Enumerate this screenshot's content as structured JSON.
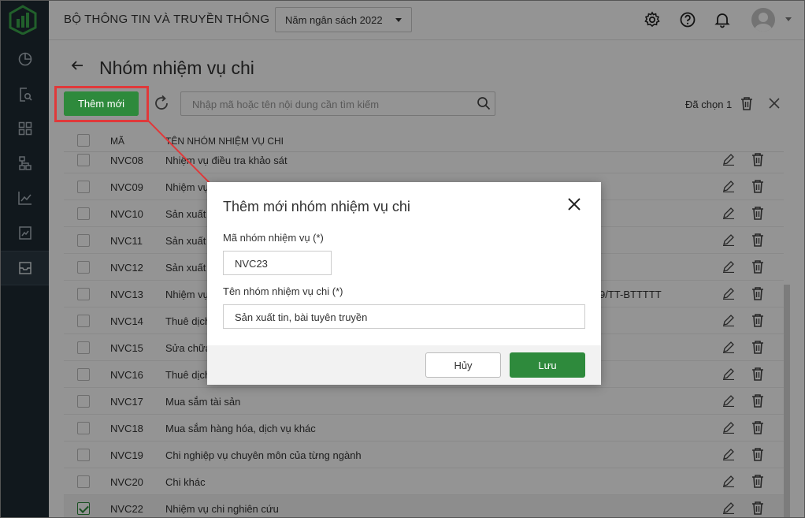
{
  "header": {
    "org_title": "BỘ THÔNG TIN VÀ TRUYỀN THÔNG",
    "budget_year": "Năm ngân sách 2022"
  },
  "page": {
    "title": "Nhóm nhiệm vụ chi",
    "add_button": "Thêm mới",
    "search_placeholder": "Nhập mã hoặc tên nội dung cần tìm kiếm",
    "selected_count": "Đã chọn 1"
  },
  "table": {
    "headers": {
      "code": "MÃ",
      "name": "TÊN NHÓM NHIỆM VỤ CHI"
    },
    "rows": [
      {
        "code": "NVC08",
        "name": "Nhiệm vụ điều tra khảo sát",
        "checked": false
      },
      {
        "code": "NVC09",
        "name": "Nhiệm vụ",
        "checked": false
      },
      {
        "code": "NVC10",
        "name": "Sản xuất",
        "checked": false
      },
      {
        "code": "NVC11",
        "name": "Sản xuất",
        "checked": false
      },
      {
        "code": "NVC12",
        "name": "Sản xuất",
        "checked": false
      },
      {
        "code": "NVC13",
        "name": "Nhiệm vụ",
        "suffix": "9/TT-BTTTTT",
        "checked": false
      },
      {
        "code": "NVC14",
        "name": "Thuê dịch",
        "checked": false
      },
      {
        "code": "NVC15",
        "name": "Sửa chữa",
        "checked": false
      },
      {
        "code": "NVC16",
        "name": "Thuê dịch",
        "checked": false
      },
      {
        "code": "NVC17",
        "name": "Mua sắm tài sản",
        "checked": false
      },
      {
        "code": "NVC18",
        "name": "Mua sắm hàng hóa, dịch vụ khác",
        "checked": false
      },
      {
        "code": "NVC19",
        "name": "Chi nghiệp vụ chuyên môn của từng ngành",
        "checked": false
      },
      {
        "code": "NVC20",
        "name": "Chi khác",
        "checked": false
      },
      {
        "code": "NVC22",
        "name": "Nhiệm vụ chi nghiên cứu",
        "checked": true
      }
    ]
  },
  "dialog": {
    "title": "Thêm mới nhóm nhiệm vụ chi",
    "code_label": "Mã nhóm nhiệm vụ (*)",
    "code_value": "NVC23",
    "name_label": "Tên nhóm nhiệm vụ chi (*)",
    "name_value": "Sản xuất tin, bài tuyên truyền",
    "cancel_label": "Hủy",
    "save_label": "Lưu"
  },
  "colors": {
    "primary_green": "#2e8a3c",
    "sidebar_bg": "#1e2a33",
    "annotation_red": "#e0393a"
  }
}
